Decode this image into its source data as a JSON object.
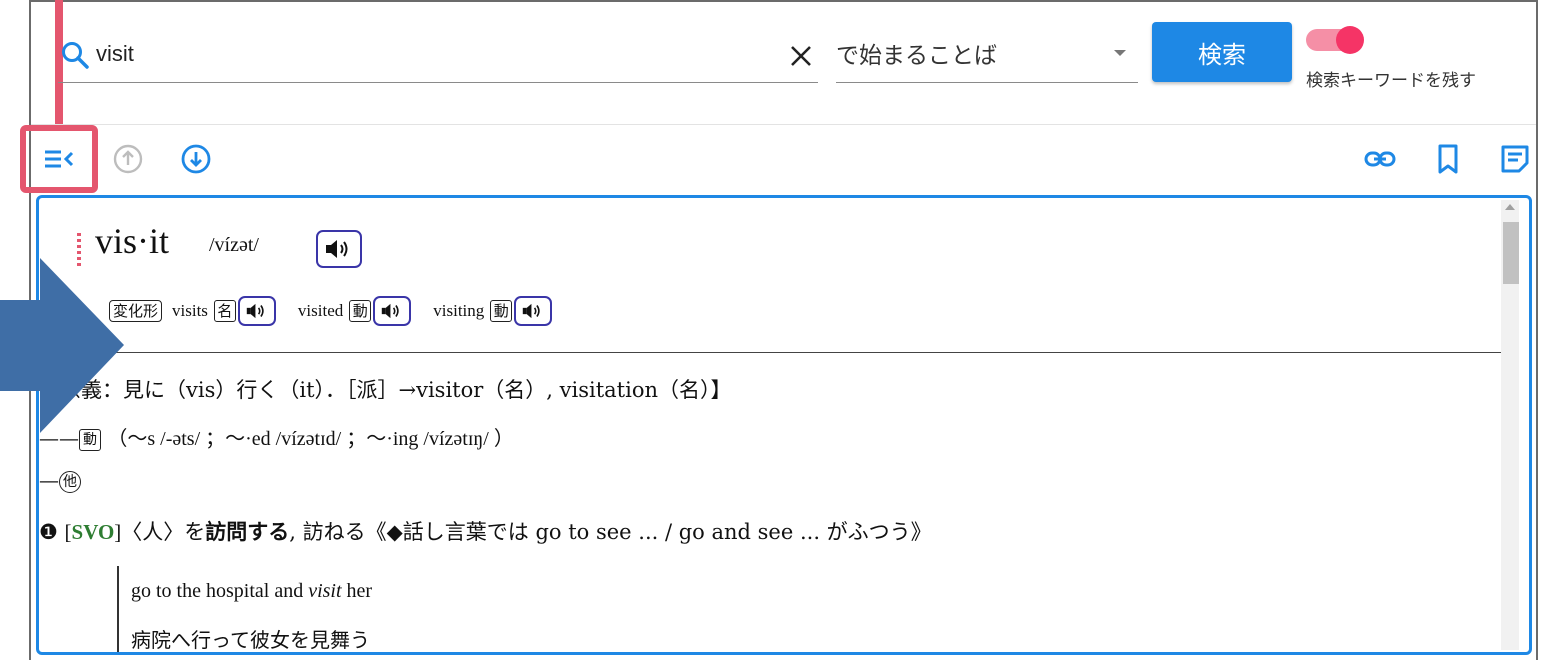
{
  "search": {
    "query": "visit",
    "mode": "で始まることば",
    "button_label": "検索",
    "keep_keyword_label": "検索キーワードを残す",
    "keep_keyword_on": true
  },
  "toolbar": {
    "icons": [
      "collapse-list-icon",
      "arrow-up-circle-icon",
      "arrow-down-circle-icon",
      "link-icon",
      "bookmark-icon",
      "note-icon"
    ]
  },
  "entry": {
    "headword": "vis·it",
    "pronunciation": "/vízət/",
    "inflection_label": "変化形",
    "inflections": [
      {
        "word": "visits",
        "pos": "名"
      },
      {
        "word": "visited",
        "pos": "動"
      },
      {
        "word": "visiting",
        "pos": "動"
      }
    ],
    "etymology": "【原義：見に（vis）行く（it）．［派］→visitor（名）, visitation（名）】",
    "verb_prefix": "——",
    "verb_pos": "動",
    "verb_forms": "（〜s /-əts/ ；〜·ed /vízətɪd/ ；〜·ing /vízətɪŋ/ ）",
    "transitive_prefix": "—",
    "transitive_mark": "他",
    "sense_number": "❶",
    "sense_pattern_open": "[",
    "sense_pattern": "SVO",
    "sense_pattern_close": "]",
    "sense_object": "〈人〉を",
    "sense_meaning": "訪問する",
    "sense_rest": ", 訪ねる《◆話し言葉では go to see ... / go and see ... がふつう》",
    "examples": [
      {
        "en_pre": "go to the hospital and ",
        "en_em": "visit",
        "en_post": " her",
        "ja": "病院へ行って彼女を見舞う"
      }
    ]
  },
  "colors": {
    "accent": "#1e88e5",
    "highlight": "#e4566e",
    "toggle": "#f53466",
    "pattern_green": "#2e7d32",
    "annotation_arrow": "#3f6ea6"
  }
}
